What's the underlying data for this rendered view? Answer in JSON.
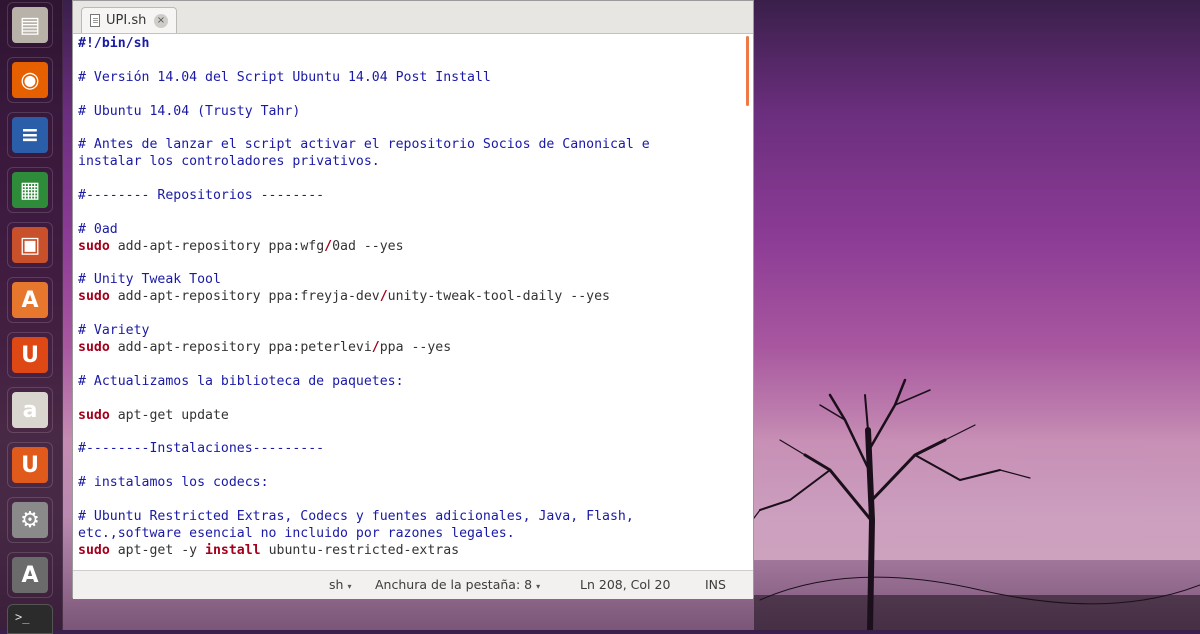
{
  "tab": {
    "title": "UPI.sh",
    "close_glyph": "×"
  },
  "code_lines": [
    [
      {
        "c": "sh",
        "t": "#!/bin/sh"
      }
    ],
    [],
    [
      {
        "c": "cm",
        "t": "# Versión 14.04 del Script Ubuntu 14.04 Post Install"
      }
    ],
    [],
    [
      {
        "c": "cm",
        "t": "# Ubuntu 14.04 (Trusty Tahr)"
      }
    ],
    [],
    [
      {
        "c": "cm",
        "t": "# Antes de lanzar el script activar el repositorio Socios de Canonical e"
      }
    ],
    [
      {
        "c": "cm",
        "t": "instalar los controladores privativos."
      }
    ],
    [],
    [
      {
        "c": "cm",
        "t": "#-------- Repositorios --------"
      }
    ],
    [],
    [
      {
        "c": "cm",
        "t": "# 0ad"
      }
    ],
    [
      {
        "c": "kw",
        "t": "sudo"
      },
      {
        "c": "",
        "t": " add-apt-repository ppa:wfg"
      },
      {
        "c": "op",
        "t": "/"
      },
      {
        "c": "",
        "t": "0ad --yes"
      }
    ],
    [],
    [
      {
        "c": "cm",
        "t": "# Unity Tweak Tool"
      }
    ],
    [
      {
        "c": "kw",
        "t": "sudo"
      },
      {
        "c": "",
        "t": " add-apt-repository ppa:freyja-dev"
      },
      {
        "c": "op",
        "t": "/"
      },
      {
        "c": "",
        "t": "unity-tweak-tool-daily --yes"
      }
    ],
    [],
    [
      {
        "c": "cm",
        "t": "# Variety"
      }
    ],
    [
      {
        "c": "kw",
        "t": "sudo"
      },
      {
        "c": "",
        "t": " add-apt-repository ppa:peterlevi"
      },
      {
        "c": "op",
        "t": "/"
      },
      {
        "c": "",
        "t": "ppa --yes"
      }
    ],
    [],
    [
      {
        "c": "cm",
        "t": "# Actualizamos la biblioteca de paquetes:"
      }
    ],
    [],
    [
      {
        "c": "kw",
        "t": "sudo"
      },
      {
        "c": "",
        "t": " apt-get update"
      }
    ],
    [],
    [
      {
        "c": "cm",
        "t": "#--------Instalaciones---------"
      }
    ],
    [],
    [
      {
        "c": "cm",
        "t": "# instalamos los codecs:"
      }
    ],
    [],
    [
      {
        "c": "cm",
        "t": "# Ubuntu Restricted Extras, Codecs y fuentes adicionales, Java, Flash,"
      }
    ],
    [
      {
        "c": "cm",
        "t": "etc.,software esencial no incluido por razones legales."
      }
    ],
    [
      {
        "c": "kw",
        "t": "sudo"
      },
      {
        "c": "",
        "t": " apt-get -y "
      },
      {
        "c": "kw",
        "t": "install"
      },
      {
        "c": "",
        "t": " ubuntu-restricted-extras"
      }
    ]
  ],
  "statusbar": {
    "language": "sh",
    "tab_width": "Anchura de la pestaña: 8",
    "position": "Ln 208, Col 20",
    "mode": "INS",
    "dropdown_glyph": "▾"
  },
  "launcher": [
    {
      "name": "files-icon",
      "glyph": "▤",
      "color": "#b8b2a8"
    },
    {
      "name": "firefox-icon",
      "glyph": "◉",
      "color": "#e66000"
    },
    {
      "name": "libreoffice-writer-icon",
      "glyph": "≡",
      "color": "#2a5ea8"
    },
    {
      "name": "libreoffice-calc-icon",
      "glyph": "▦",
      "color": "#2e8b3a"
    },
    {
      "name": "libreoffice-impress-icon",
      "glyph": "▣",
      "color": "#c8502a"
    },
    {
      "name": "software-center-icon",
      "glyph": "A",
      "color": "#e8772e"
    },
    {
      "name": "ubuntu-one-icon",
      "glyph": "U",
      "color": "#dd4814"
    },
    {
      "name": "amazon-icon",
      "glyph": "a",
      "color": "#d9d6d0"
    },
    {
      "name": "ubuntu-one-music-icon",
      "glyph": "U",
      "color": "#e05a1c"
    },
    {
      "name": "system-settings-icon",
      "glyph": "⚙",
      "color": "#8a8a8a"
    },
    {
      "name": "software-updater-icon",
      "glyph": "A",
      "color": "#6b6b6b"
    }
  ],
  "terminal_peek": ">_",
  "colors": {
    "accent": "#f07746",
    "comment": "#1a1aa6",
    "keyword": "#a4001c"
  }
}
